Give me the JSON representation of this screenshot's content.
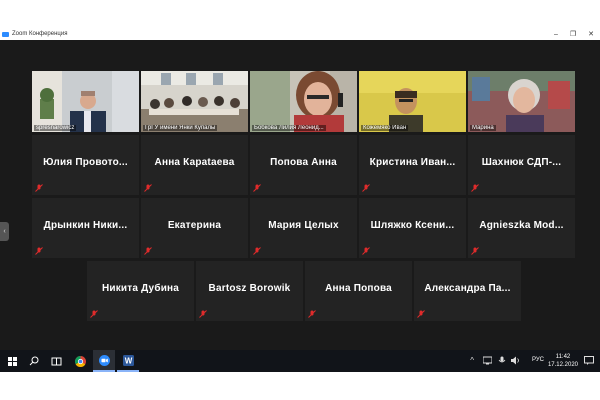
{
  "window": {
    "title": "Zoom Конференция",
    "minimize": "–",
    "maximize": "❐",
    "close": "✕"
  },
  "side_handle": "‹",
  "video_tiles": [
    {
      "label": "spresnarowicz",
      "active": false,
      "scene": "office-man"
    },
    {
      "label": "ГрГУ имени Янки Купалы",
      "active": false,
      "scene": "classroom"
    },
    {
      "label": "Бобкова Лилия Леонид...",
      "active": false,
      "scene": "woman-headphones"
    },
    {
      "label": "Кожемяко Иван",
      "active": false,
      "scene": "yellow-room"
    },
    {
      "label": "Марина",
      "active": true,
      "scene": "woman-room"
    }
  ],
  "participants_row2": [
    "Юлия Провото...",
    "Анна Караtaeва",
    "Попова Анна",
    "Кристина Иван...",
    "Шахнюк СДП-..."
  ],
  "participants_row3": [
    "Дрынкин Ники...",
    "Екатерина",
    "Мария Целых",
    "Шляжко Ксени...",
    "Agnieszka Mod..."
  ],
  "participants_row4": [
    "Никита Дубина",
    "Bartosz Borowik",
    "Анна Попова",
    "Александра Па..."
  ],
  "taskbar": {
    "language": "РУС",
    "time": "11:42",
    "date": "17.12.2020",
    "tray_up": "^",
    "icons": [
      "windows-start-icon",
      "search-icon",
      "task-view-icon",
      "chrome-icon",
      "zoom-icon",
      "word-icon"
    ]
  },
  "colors": {
    "canvas": "#1a1a1a",
    "tile": "#232323",
    "active_speaker": "#c8e000",
    "mute_icon": "#e02b2b",
    "zoom_blue": "#2D8CFF"
  }
}
